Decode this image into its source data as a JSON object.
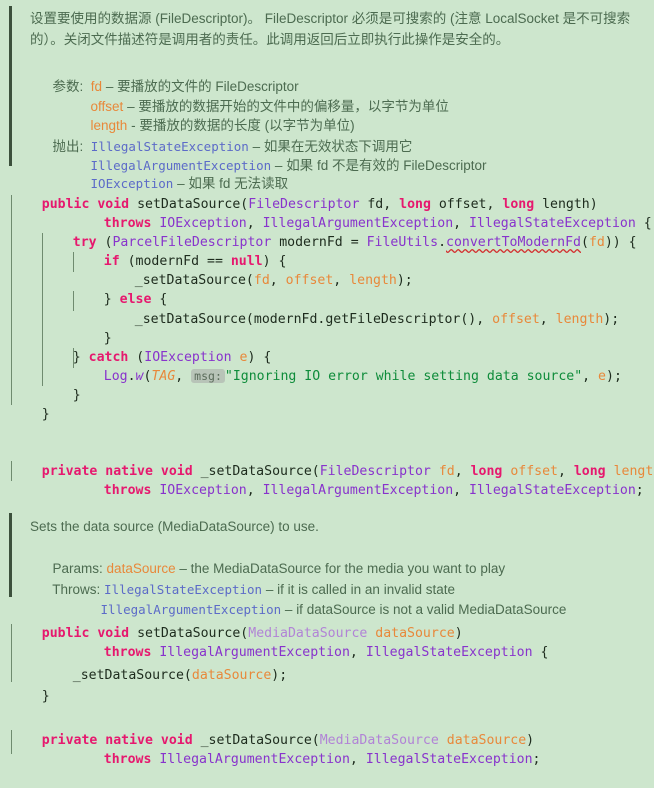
{
  "editor": {
    "background_color": "#CDE6CD",
    "keyword_color": "#E6186E",
    "type_color": "#8833CC",
    "param_color": "#E8883A",
    "string_color": "#0E8C3A",
    "doc_text_color": "#4C6B50",
    "doc_link_color": "#5C6BC8",
    "error_underline_color": "#D32F2F"
  },
  "doc_block_1": {
    "line1": "设置要使用的数据源 (FileDescriptor)。 FileDescriptor 必须是可搜索的 (注意 LocalSocket 是不可搜索",
    "line2": "的）。关闭文件描述符是调用者的责任。此调用返回后立即执行此操作是安全的。",
    "params_label": "参数:",
    "params": [
      {
        "name": "fd",
        "dash": "–",
        "desc": "要播放的文件的 FileDescriptor"
      },
      {
        "name": "offset",
        "dash": "–",
        "desc": "要播放的数据开始的文件中的偏移量，以字节为单位"
      },
      {
        "name": "length",
        "dash": "-",
        "desc": "要播放的数据的长度 (以字节为单位)"
      }
    ],
    "throws_label": "抛出:",
    "throws": [
      {
        "name": "IllegalStateException",
        "dash": "–",
        "desc": "如果在无效状态下调用它"
      },
      {
        "name": "IllegalArgumentException",
        "dash": "–",
        "desc": "如果 fd 不是有效的 FileDescriptor"
      },
      {
        "name": "IOException",
        "dash": "–",
        "desc": "如果 fd 无法读取"
      }
    ]
  },
  "code_block_1": {
    "l1": {
      "kw1": "public",
      "kw2": "void",
      "method": "setDataSource",
      "open": "(",
      "type1": "FileDescriptor",
      "p1": "fd",
      "c1": ", ",
      "kw3": "long",
      "p2": "offset",
      "c2": ", ",
      "kw4": "long",
      "p3": "length",
      "close": ")"
    },
    "l2": {
      "throws": "throws",
      "e1": "IOException",
      "c1": ", ",
      "e2": "IllegalArgumentException",
      "c2": ", ",
      "e3": "IllegalStateException",
      "brace": " {"
    },
    "l3": {
      "kw": "try",
      "open": " (",
      "type": "ParcelFileDescriptor",
      "var": "modernFd",
      "eq": " = ",
      "cls": "FileUtils",
      "dot": ".",
      "call": "convertToModernFd",
      "o2": "(",
      "arg": "fd",
      "close": ")) {"
    },
    "l4": {
      "kw": "if",
      "open": " (",
      "var": "modernFd",
      "op": " == ",
      "kw2": "null",
      "close": ") {"
    },
    "l5": {
      "call": "_setDataSource",
      "open": "(",
      "a1": "fd",
      "c1": ", ",
      "a2": "offset",
      "c2": ", ",
      "a3": "length",
      "close": ");"
    },
    "l6": {
      "text": "} ",
      "kw": "else",
      "brace": " {"
    },
    "l7": {
      "call": "_setDataSource",
      "open": "(",
      "recv": "modernFd",
      "dot": ".",
      "meth": "getFileDescriptor",
      "par": "()",
      "c1": ", ",
      "a2": "offset",
      "c2": ", ",
      "a3": "length",
      "close": ");"
    },
    "l8": {
      "text": "}"
    },
    "l9": {
      "text": "} ",
      "kw": "catch",
      "open": " (",
      "type": "IOException",
      "var": "e",
      "close": ") {"
    },
    "l10": {
      "cls": "Log",
      "dot": ".",
      "meth": "w",
      "open": "(",
      "tag": "TAG",
      "c1": ", ",
      "hint": "msg:",
      "str": "\"Ignoring IO error while setting data source\"",
      "c2": ", ",
      "e": "e",
      "close": ");"
    },
    "l11": {
      "text": "}"
    },
    "l12": {
      "text": "}"
    }
  },
  "code_block_2": {
    "l1": {
      "kw1": "private",
      "kw2": "native",
      "kw3": "void",
      "method": "_setDataSource",
      "open": "(",
      "type1": "FileDescriptor",
      "p1": "fd",
      "c1": ", ",
      "kw4": "long",
      "p2": "offset",
      "c2": ", ",
      "kw5": "long",
      "p3": "length",
      "close": ")"
    },
    "l2": {
      "throws": "throws",
      "e1": "IOException",
      "c1": ", ",
      "e2": "IllegalArgumentException",
      "c2": ", ",
      "e3": "IllegalStateException",
      "semi": ";"
    }
  },
  "doc_block_2": {
    "line1": "Sets the data source (MediaDataSource) to use.",
    "params_label": "Params:",
    "param_name": "dataSource",
    "param_dash": "–",
    "param_desc": "the MediaDataSource for the media you want to play",
    "throws_label": "Throws:",
    "throws": [
      {
        "name": "IllegalStateException",
        "dash": "–",
        "desc": "if it is called in an invalid state"
      },
      {
        "name": "IllegalArgumentException",
        "dash": "–",
        "desc": "if dataSource is not a valid MediaDataSource"
      }
    ]
  },
  "code_block_3": {
    "l1": {
      "kw1": "public",
      "kw2": "void",
      "method": "setDataSource",
      "open": "(",
      "type1": "MediaDataSource",
      "p1": "dataSource",
      "close": ")"
    },
    "l2": {
      "throws": "throws",
      "e1": "IllegalArgumentException",
      "c1": ", ",
      "e2": "IllegalStateException",
      "brace": " {"
    },
    "l3": {
      "call": "_setDataSource",
      "open": "(",
      "a1": "dataSource",
      "close": ");"
    },
    "l4": {
      "text": "}"
    }
  },
  "code_block_4": {
    "l1": {
      "kw1": "private",
      "kw2": "native",
      "kw3": "void",
      "method": "_setDataSource",
      "open": "(",
      "type1": "MediaDataSource",
      "p1": "dataSource",
      "close": ")"
    },
    "l2": {
      "throws": "throws",
      "e1": "IllegalArgumentException",
      "c1": ", ",
      "e2": "IllegalStateException",
      "semi": ";"
    }
  }
}
